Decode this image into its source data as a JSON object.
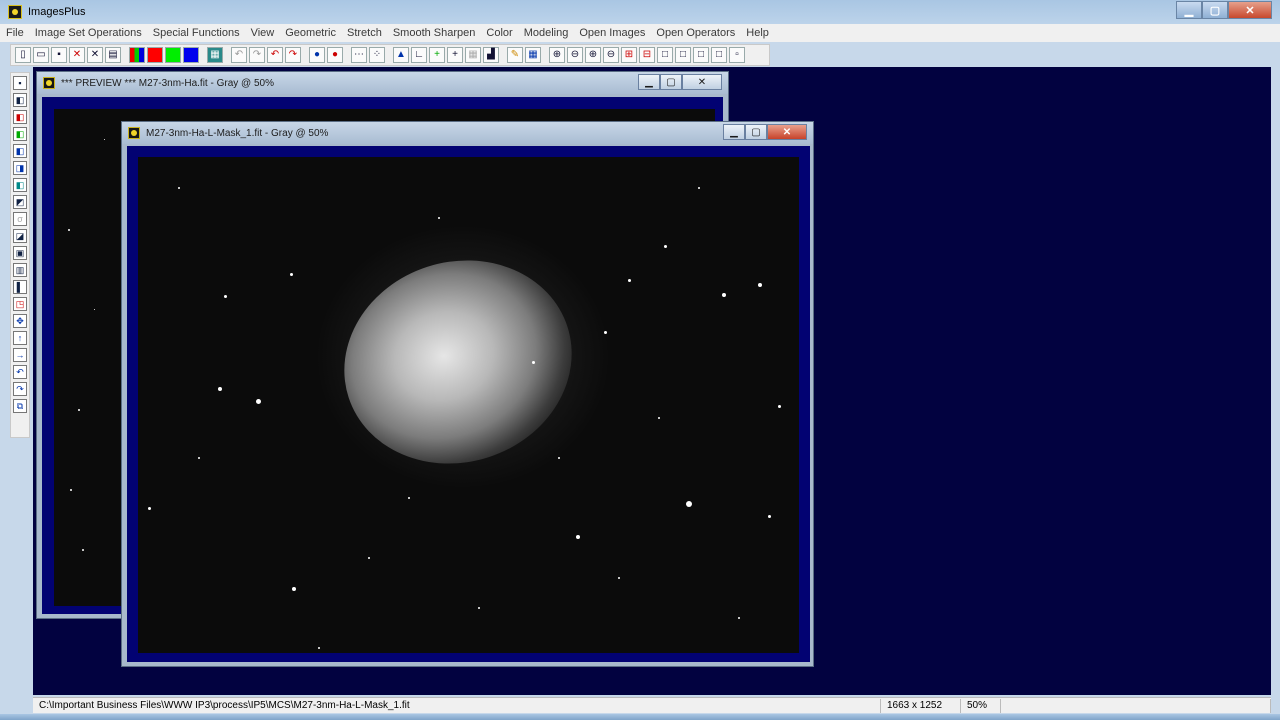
{
  "app": {
    "title": "ImagesPlus"
  },
  "menu": {
    "items": [
      "File",
      "Image Set Operations",
      "Special Functions",
      "View",
      "Geometric",
      "Stretch",
      "Smooth Sharpen",
      "Color",
      "Modeling",
      "Open Images",
      "Open Operators",
      "Help"
    ]
  },
  "windows": {
    "preview": {
      "title": "*** PREVIEW *** M27-3nm-Ha.fit - Gray @ 50%"
    },
    "mask": {
      "title": "M27-3nm-Ha-L-Mask_1.fit - Gray @ 50%"
    }
  },
  "status": {
    "path": "C:\\Important Business Files\\WWW IP3\\process\\IP5\\MCS\\M27-3nm-Ha-L-Mask_1.fit",
    "dimensions": "1663 x 1252",
    "zoom": "50%"
  },
  "colors": {
    "workspace": "#020240",
    "canvas_frame": "#020272"
  }
}
